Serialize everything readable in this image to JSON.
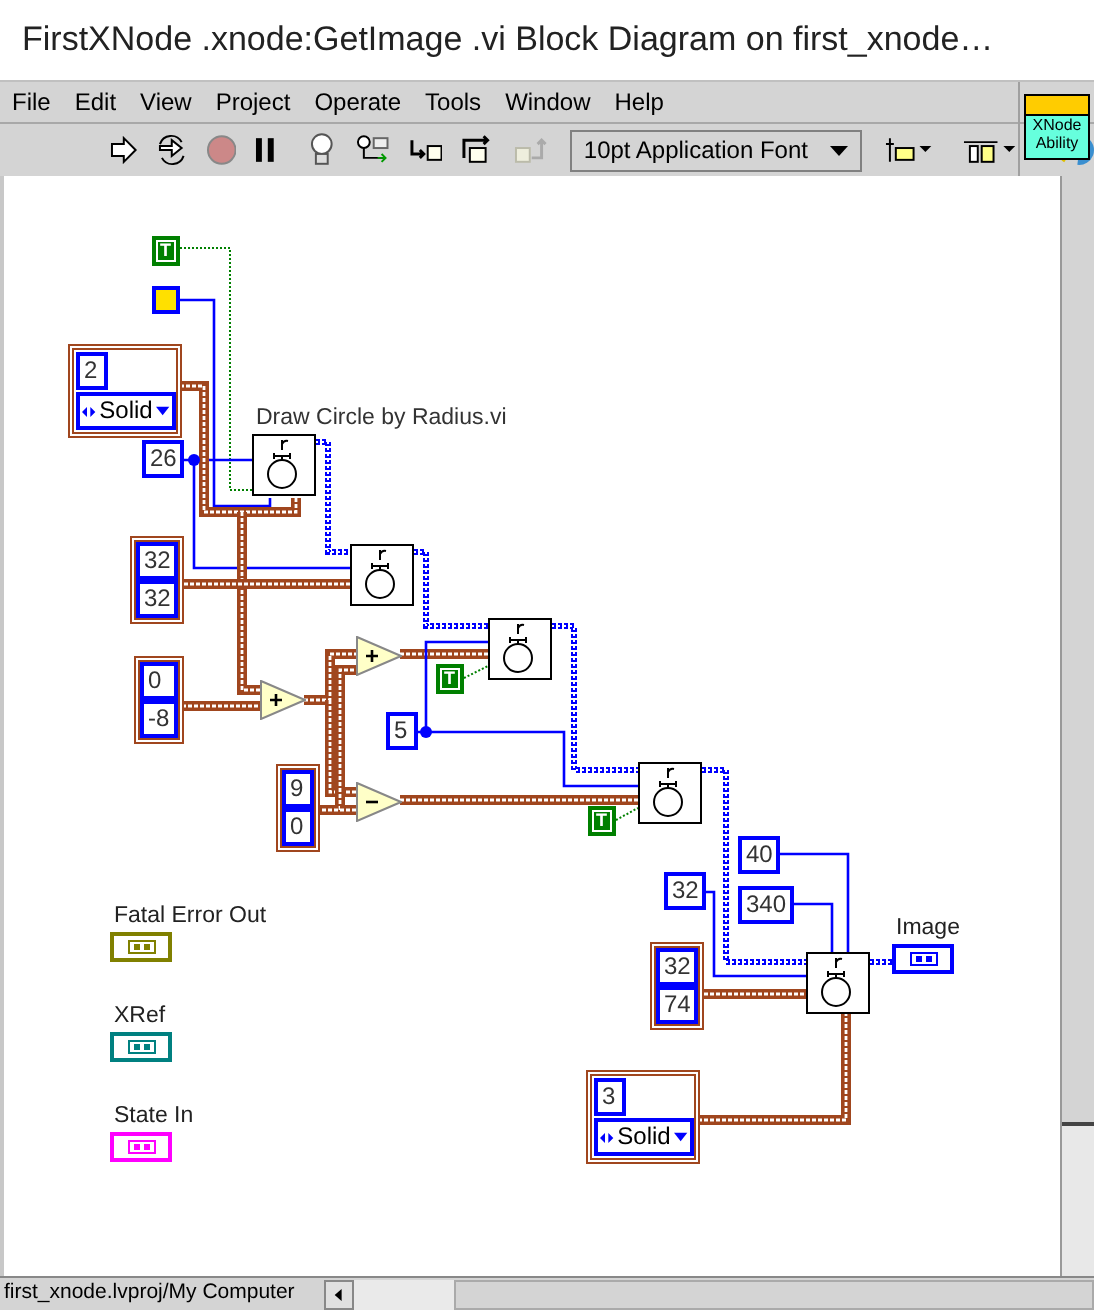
{
  "window": {
    "title": "FirstXNode .xnode:GetImage .vi Block Diagram on first_xnode…"
  },
  "menu": [
    "File",
    "Edit",
    "View",
    "Project",
    "Operate",
    "Tools",
    "Window",
    "Help"
  ],
  "toolbar": {
    "font": "10pt Application Font"
  },
  "vi_icon": "XNode Ability",
  "diagram": {
    "nodes": [
      {
        "kind": "boolean",
        "text": "T"
      },
      {
        "kind": "color"
      },
      {
        "kind": "cluster",
        "number": "2",
        "enum": "Solid"
      },
      {
        "kind": "label",
        "text": "Draw Circle by Radius.vi"
      },
      {
        "kind": "numeric",
        "text": "26"
      },
      {
        "kind": "subvi"
      },
      {
        "kind": "array",
        "values": [
          "32",
          "32"
        ]
      },
      {
        "kind": "subvi"
      },
      {
        "kind": "array",
        "values": [
          "0",
          "-8"
        ]
      },
      {
        "kind": "add"
      },
      {
        "kind": "add"
      },
      {
        "kind": "subvi"
      },
      {
        "kind": "boolean",
        "text": "T"
      },
      {
        "kind": "numeric",
        "text": "5"
      },
      {
        "kind": "array",
        "values": [
          "9",
          "0"
        ]
      },
      {
        "kind": "subtract"
      },
      {
        "kind": "subvi"
      },
      {
        "kind": "boolean",
        "text": "T"
      },
      {
        "kind": "numeric",
        "text": "40"
      },
      {
        "kind": "numeric",
        "text": "340"
      },
      {
        "kind": "numeric",
        "text": "32"
      },
      {
        "kind": "array",
        "values": [
          "32",
          "74"
        ]
      },
      {
        "kind": "subvi"
      },
      {
        "kind": "terminal",
        "label": "Image",
        "color": "#0000ff"
      },
      {
        "kind": "cluster",
        "number": "3",
        "enum": "Solid"
      },
      {
        "kind": "terminal",
        "label": "Fatal Error Out",
        "color": "#808000"
      },
      {
        "kind": "terminal",
        "label": "XRef",
        "color": "#008080"
      },
      {
        "kind": "terminal",
        "label": "State In",
        "color": "#ff00ff"
      }
    ]
  },
  "status_bar": "first_xnode.lvproj/My Computer"
}
